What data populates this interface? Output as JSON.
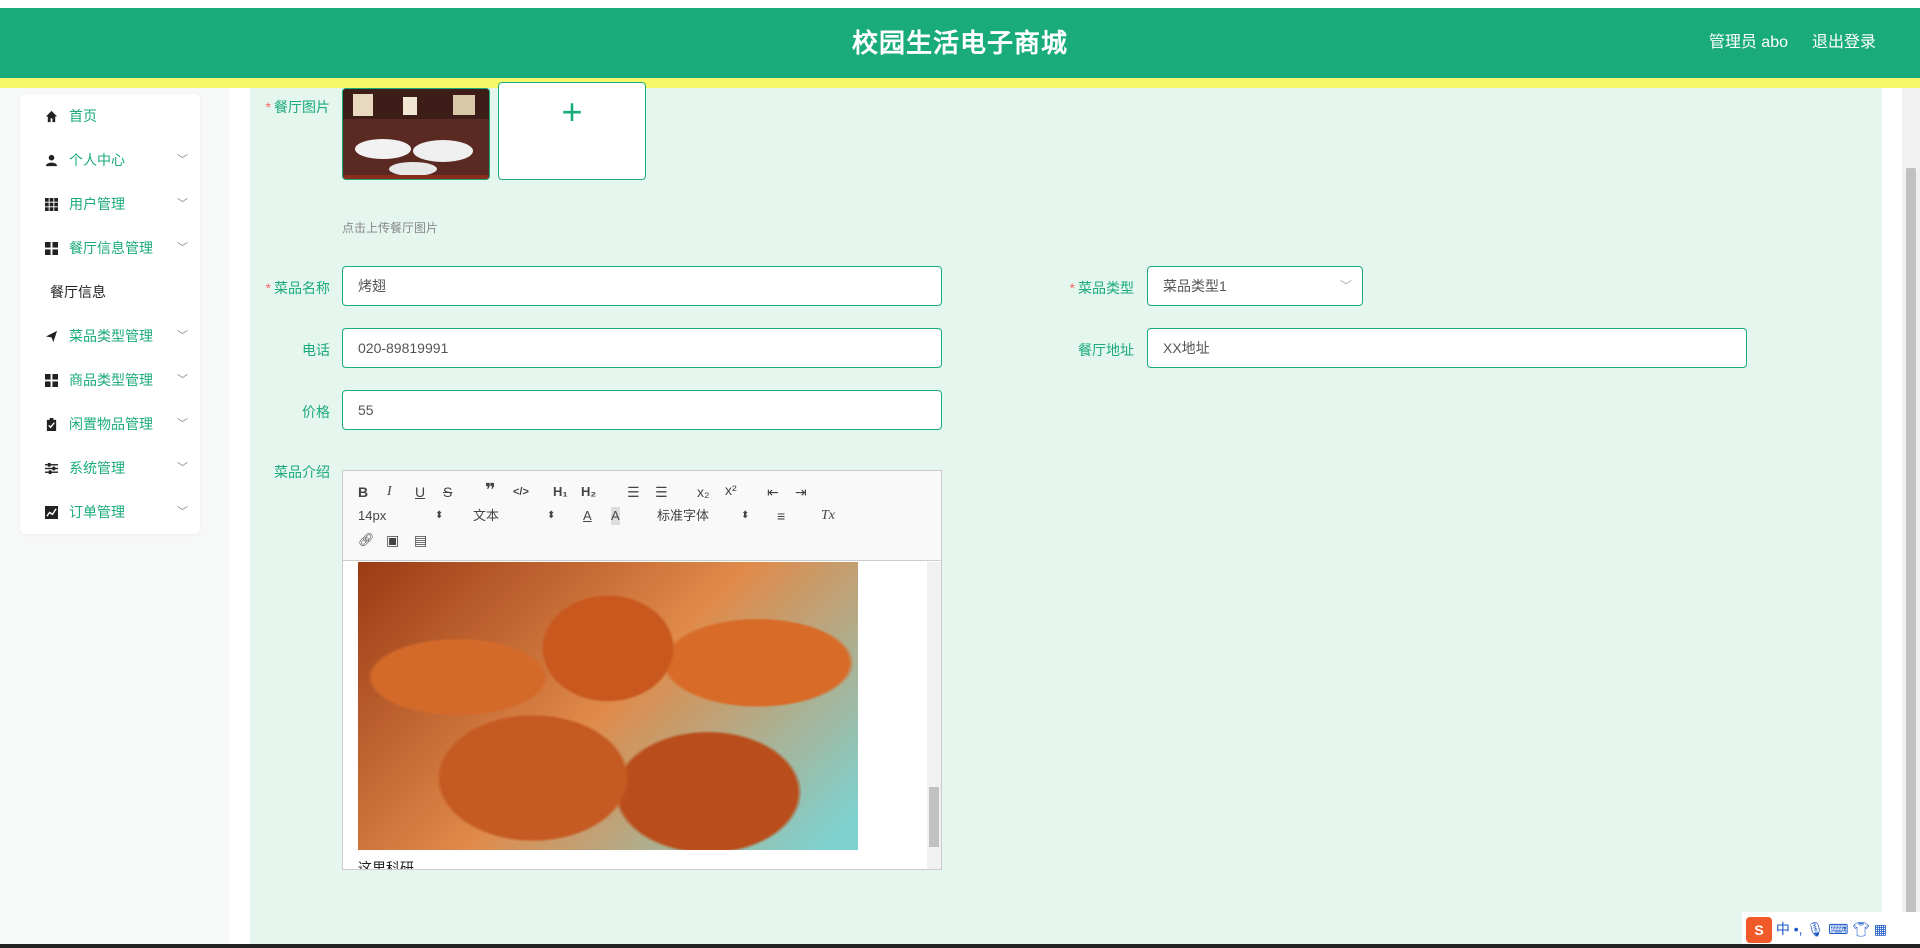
{
  "header": {
    "title": "校园生活电子商城",
    "user": "管理员 abo",
    "logout": "退出登录"
  },
  "sidebar": {
    "items": [
      {
        "label": "首页",
        "icon": "home-icon",
        "chevron": false
      },
      {
        "label": "个人中心",
        "icon": "user-icon",
        "chevron": true
      },
      {
        "label": "用户管理",
        "icon": "grid-icon",
        "chevron": true
      },
      {
        "label": "餐厅信息管理",
        "icon": "apps-icon",
        "chevron": true
      }
    ],
    "sub_item": "餐厅信息",
    "items2": [
      {
        "label": "菜品类型管理",
        "icon": "send-icon",
        "chevron": true
      },
      {
        "label": "商品类型管理",
        "icon": "apps-icon",
        "chevron": true
      },
      {
        "label": "闲置物品管理",
        "icon": "clipboard-icon",
        "chevron": true
      },
      {
        "label": "系统管理",
        "icon": "sliders-icon",
        "chevron": true
      },
      {
        "label": "订单管理",
        "icon": "chart-icon",
        "chevron": true
      }
    ]
  },
  "form": {
    "image_label": "餐厅图片",
    "upload_plus": "+",
    "upload_hint": "点击上传餐厅图片",
    "dish_name_label": "菜品名称",
    "dish_name_value": "烤翅",
    "dish_type_label": "菜品类型",
    "dish_type_value": "菜品类型1",
    "phone_label": "电话",
    "phone_value": "020-89819991",
    "address_label": "餐厅地址",
    "address_value": "XX地址",
    "price_label": "价格",
    "price_value": "55",
    "intro_label": "菜品介绍"
  },
  "editor": {
    "font_size": "14px",
    "text_type": "文本",
    "font_family": "标准字体",
    "content_text": "这里科研"
  },
  "tray": {
    "ime": "中"
  }
}
